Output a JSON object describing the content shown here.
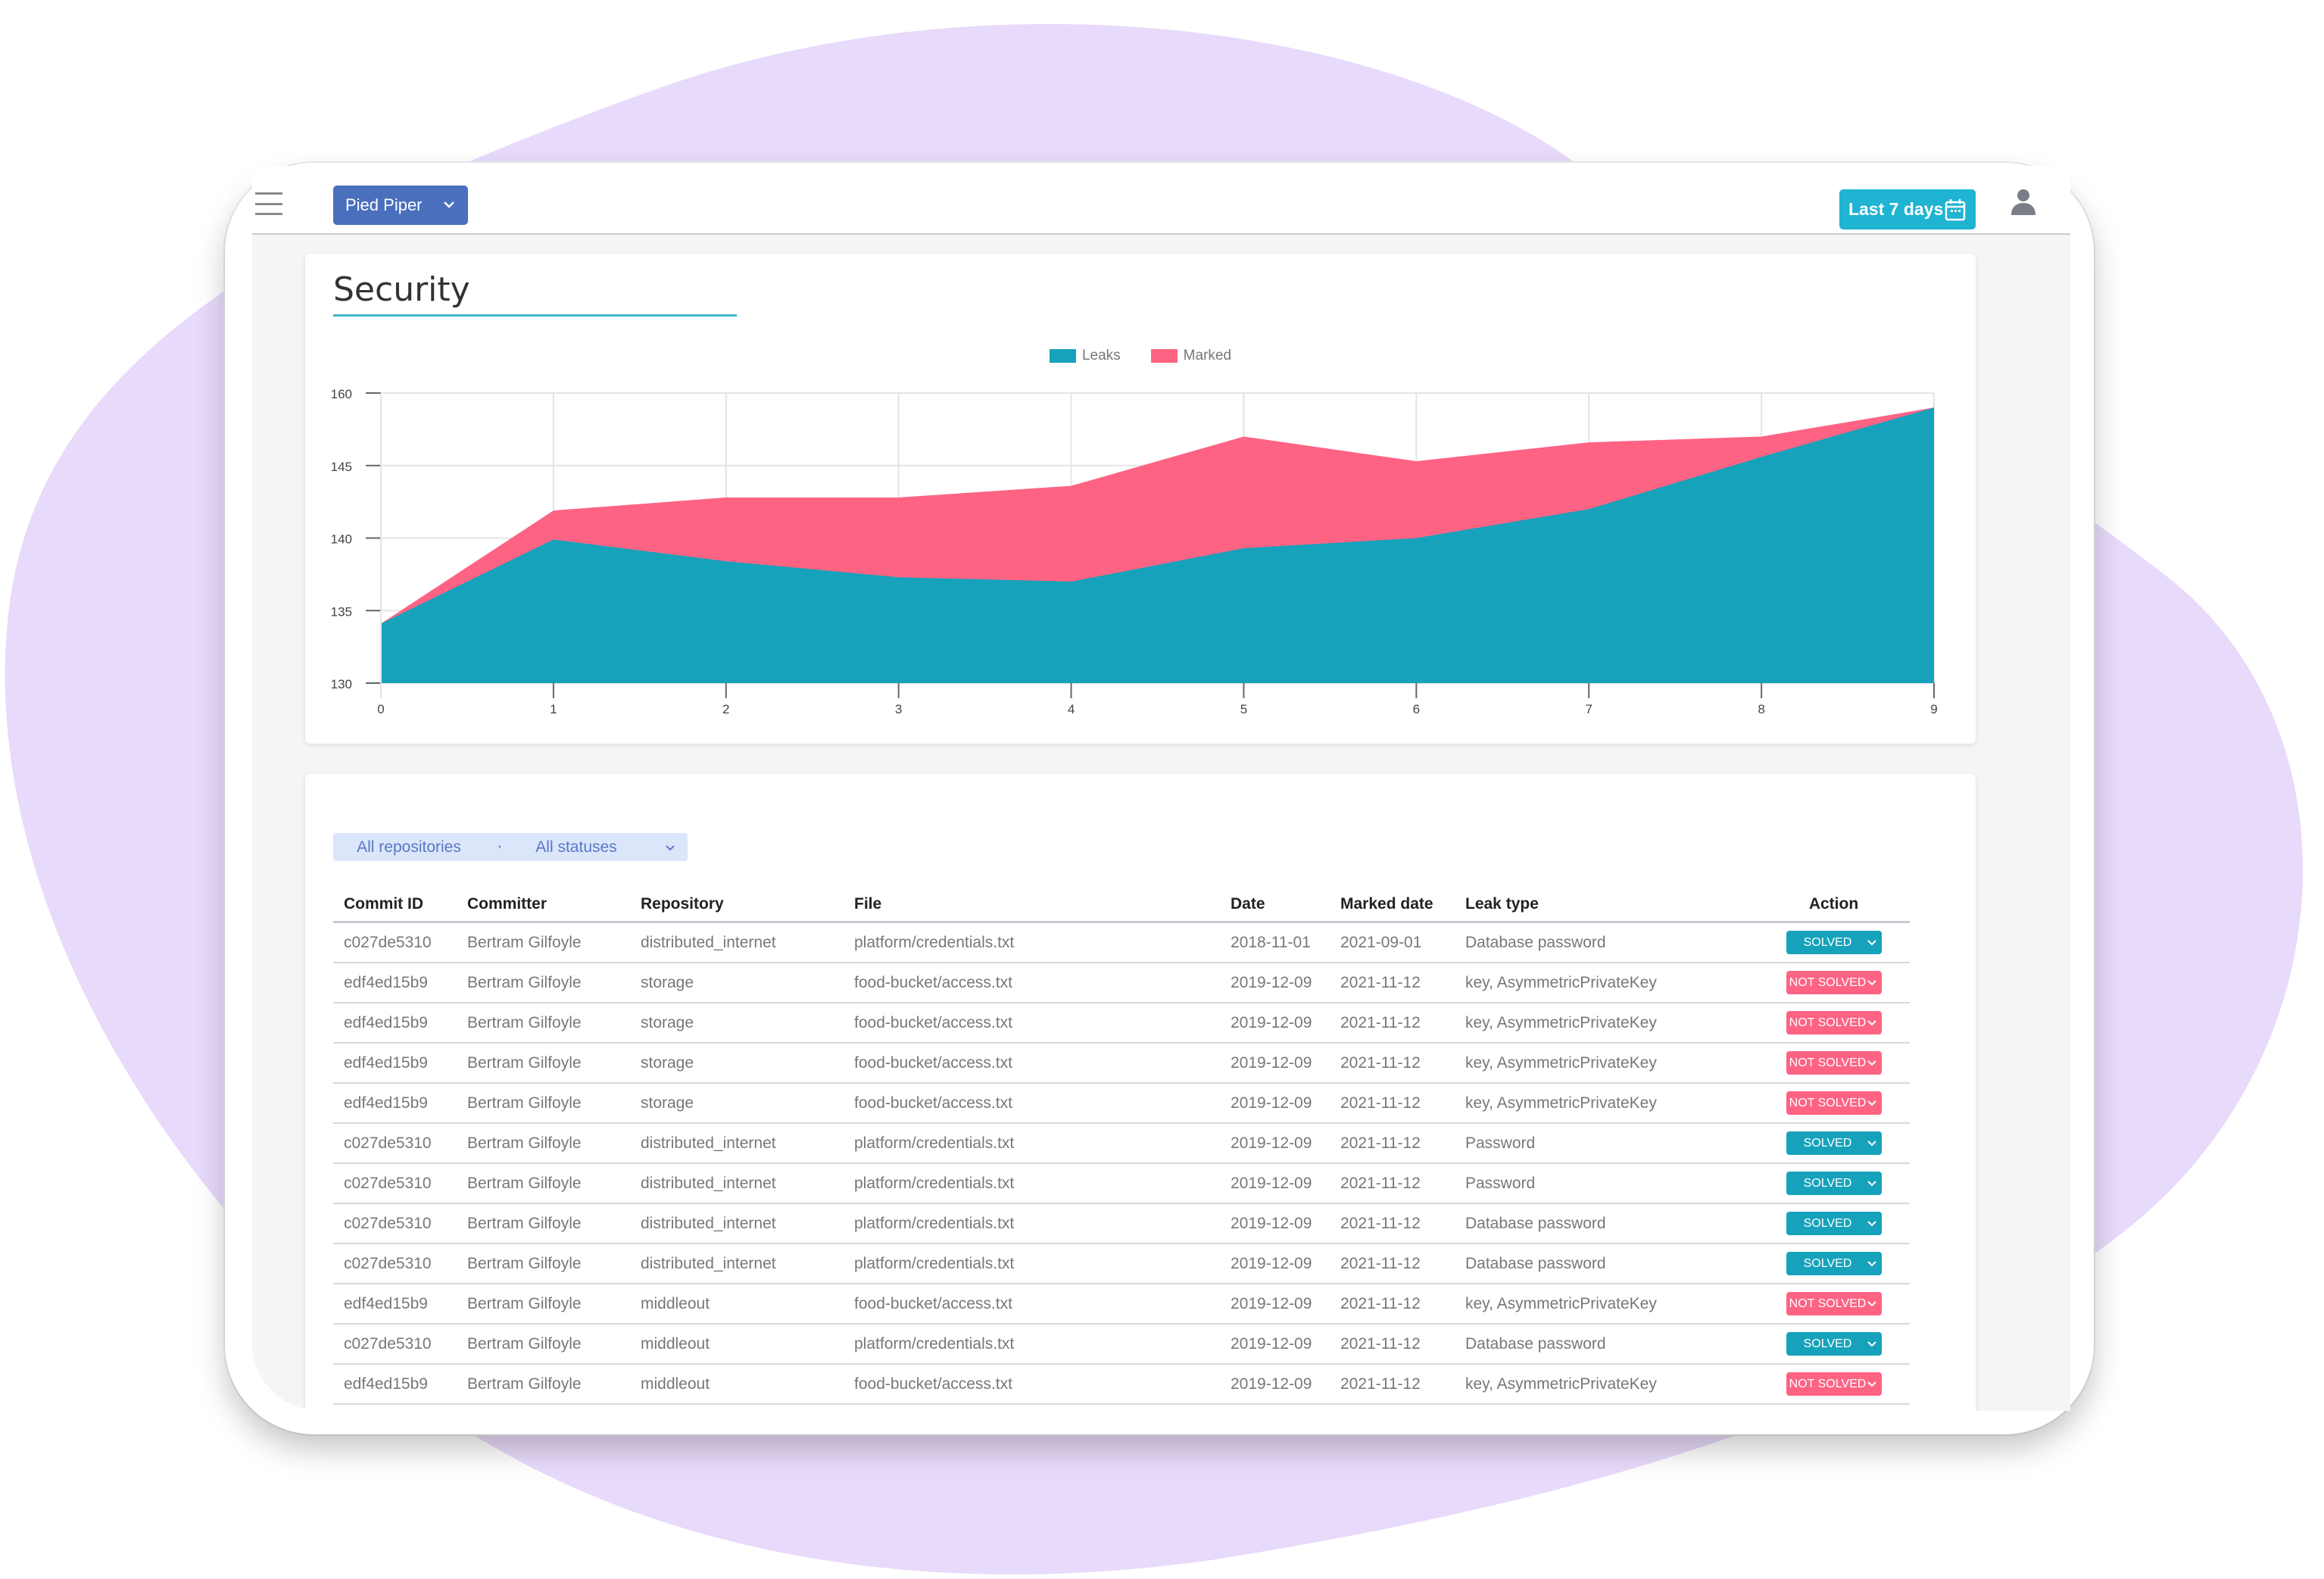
{
  "header": {
    "menu_icon": "hamburger-menu-icon",
    "org_selector": {
      "label": "Pied Piper",
      "icon": "chevron-down-icon"
    },
    "date_range": {
      "label": "Last 7 days",
      "icon": "calendar-icon"
    },
    "user_icon": "user-avatar-icon"
  },
  "colors": {
    "leaks": "#17a2bb",
    "marked": "#fe6384",
    "primary_button": "#4a6fbd",
    "accent": "#1fb4d2",
    "solved": "#17a2bb",
    "not_solved": "#fe6384",
    "background_blob": "#e8dafa"
  },
  "security": {
    "title": "Security"
  },
  "chart_data": {
    "type": "area",
    "title": "",
    "xlabel": "",
    "ylabel": "",
    "x": [
      0,
      1,
      2,
      3,
      4,
      5,
      6,
      7,
      8,
      9
    ],
    "y_tick_labels": [
      "160",
      "145",
      "140",
      "135",
      "130"
    ],
    "ylim": [
      130,
      150
    ],
    "grid": true,
    "legend": "top-center",
    "series": [
      {
        "name": "Leaks",
        "color": "#17a2bb",
        "values": [
          134.1,
          139.9,
          138.4,
          137.3,
          137.0,
          139.3,
          140.0,
          142.0,
          145.6,
          149.0
        ]
      },
      {
        "name": "Marked",
        "color": "#fe6384",
        "values": [
          134.1,
          141.9,
          142.8,
          142.8,
          143.6,
          147.0,
          145.3,
          146.6,
          147.0,
          149.0
        ]
      }
    ]
  },
  "filters": {
    "repositories": {
      "label": "All repositories"
    },
    "statuses": {
      "label": "All statuses"
    }
  },
  "table": {
    "columns": [
      "Commit ID",
      "Committer",
      "Repository",
      "File",
      "Date",
      "Marked date",
      "Leak type",
      "Action"
    ],
    "rows": [
      {
        "commit": "c027de5310",
        "committer": "Bertram Gilfoyle",
        "repo": "distributed_internet",
        "file": "platform/credentials.txt",
        "date": "2018-11-01",
        "marked": "2021-09-01",
        "type": "Database password",
        "status": "SOLVED"
      },
      {
        "commit": "edf4ed15b9",
        "committer": "Bertram Gilfoyle",
        "repo": "storage",
        "file": "food-bucket/access.txt",
        "date": "2019-12-09",
        "marked": "2021-11-12",
        "type": "key, AsymmetricPrivateKey",
        "status": "NOT SOLVED"
      },
      {
        "commit": "edf4ed15b9",
        "committer": "Bertram Gilfoyle",
        "repo": "storage",
        "file": "food-bucket/access.txt",
        "date": "2019-12-09",
        "marked": "2021-11-12",
        "type": "key, AsymmetricPrivateKey",
        "status": "NOT SOLVED"
      },
      {
        "commit": "edf4ed15b9",
        "committer": "Bertram Gilfoyle",
        "repo": "storage",
        "file": "food-bucket/access.txt",
        "date": "2019-12-09",
        "marked": "2021-11-12",
        "type": "key, AsymmetricPrivateKey",
        "status": "NOT SOLVED"
      },
      {
        "commit": "edf4ed15b9",
        "committer": "Bertram Gilfoyle",
        "repo": "storage",
        "file": "food-bucket/access.txt",
        "date": "2019-12-09",
        "marked": "2021-11-12",
        "type": "key, AsymmetricPrivateKey",
        "status": "NOT SOLVED"
      },
      {
        "commit": "c027de5310",
        "committer": "Bertram Gilfoyle",
        "repo": "distributed_internet",
        "file": "platform/credentials.txt",
        "date": "2019-12-09",
        "marked": "2021-11-12",
        "type": "Password",
        "status": "SOLVED"
      },
      {
        "commit": "c027de5310",
        "committer": "Bertram Gilfoyle",
        "repo": "distributed_internet",
        "file": "platform/credentials.txt",
        "date": "2019-12-09",
        "marked": "2021-11-12",
        "type": "Password",
        "status": "SOLVED"
      },
      {
        "commit": "c027de5310",
        "committer": "Bertram Gilfoyle",
        "repo": "distributed_internet",
        "file": "platform/credentials.txt",
        "date": "2019-12-09",
        "marked": "2021-11-12",
        "type": "Database password",
        "status": "SOLVED"
      },
      {
        "commit": "c027de5310",
        "committer": "Bertram Gilfoyle",
        "repo": "distributed_internet",
        "file": "platform/credentials.txt",
        "date": "2019-12-09",
        "marked": "2021-11-12",
        "type": "Database password",
        "status": "SOLVED"
      },
      {
        "commit": "edf4ed15b9",
        "committer": "Bertram Gilfoyle",
        "repo": "middleout",
        "file": "food-bucket/access.txt",
        "date": "2019-12-09",
        "marked": "2021-11-12",
        "type": "key, AsymmetricPrivateKey",
        "status": "NOT SOLVED"
      },
      {
        "commit": "c027de5310",
        "committer": "Bertram Gilfoyle",
        "repo": "middleout",
        "file": "platform/credentials.txt",
        "date": "2019-12-09",
        "marked": "2021-11-12",
        "type": "Database password",
        "status": "SOLVED"
      },
      {
        "commit": "edf4ed15b9",
        "committer": "Bertram Gilfoyle",
        "repo": "middleout",
        "file": "food-bucket/access.txt",
        "date": "2019-12-09",
        "marked": "2021-11-12",
        "type": "key, AsymmetricPrivateKey",
        "status": "NOT SOLVED"
      }
    ]
  }
}
